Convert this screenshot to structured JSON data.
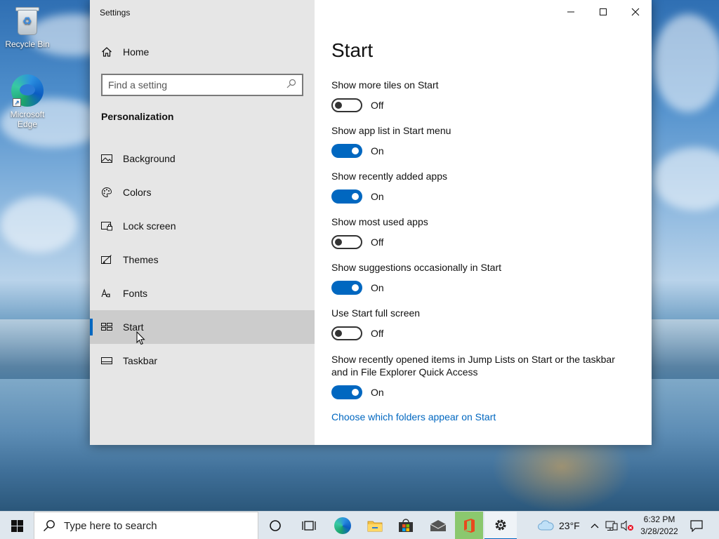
{
  "desktop": {
    "icons": [
      {
        "label": "Recycle Bin"
      },
      {
        "label": "Microsoft Edge"
      }
    ]
  },
  "window": {
    "title": "Settings",
    "controls": {
      "minimize": "minimize-icon",
      "maximize": "maximize-icon",
      "close": "close-icon"
    }
  },
  "sidebar": {
    "home": "Home",
    "search_placeholder": "Find a setting",
    "category": "Personalization",
    "items": [
      {
        "label": "Background",
        "icon": "picture-icon"
      },
      {
        "label": "Colors",
        "icon": "palette-icon"
      },
      {
        "label": "Lock screen",
        "icon": "lock-screen-icon"
      },
      {
        "label": "Themes",
        "icon": "brush-icon"
      },
      {
        "label": "Fonts",
        "icon": "font-icon"
      },
      {
        "label": "Start",
        "icon": "start-layout-icon",
        "selected": true
      },
      {
        "label": "Taskbar",
        "icon": "taskbar-icon"
      }
    ]
  },
  "main": {
    "title": "Start",
    "settings": [
      {
        "label": "Show more tiles on Start",
        "state": "Off"
      },
      {
        "label": "Show app list in Start menu",
        "state": "On"
      },
      {
        "label": "Show recently added apps",
        "state": "On"
      },
      {
        "label": "Show most used apps",
        "state": "Off"
      },
      {
        "label": "Show suggestions occasionally in Start",
        "state": "On"
      },
      {
        "label": "Use Start full screen",
        "state": "Off"
      },
      {
        "label": "Show recently opened items in Jump Lists on Start or the taskbar and in File Explorer Quick Access",
        "state": "On"
      }
    ],
    "link": "Choose which folders appear on Start"
  },
  "taskbar": {
    "search_placeholder": "Type here to search",
    "weather": "23°F",
    "time": "6:32 PM",
    "date": "3/28/2022"
  },
  "colors": {
    "accent": "#0067c0",
    "sidebar_bg": "#e6e6e6",
    "selected_bg": "#cccccc"
  }
}
